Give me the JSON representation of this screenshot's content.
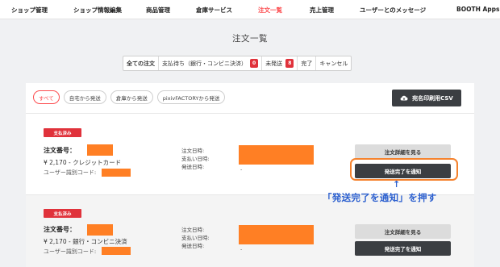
{
  "nav": {
    "items": [
      "ショップ管理",
      "ショップ情報編集",
      "商品管理",
      "倉庫サービス",
      "注文一覧",
      "売上管理",
      "ユーザーとのメッセージ",
      "BOOTH Apps"
    ],
    "active_index": 4,
    "active_color": "#fc4d50"
  },
  "page_title": "注文一覧",
  "status_tabs": [
    {
      "label": "全ての注文"
    },
    {
      "label": "支払待ち（銀行・コンビニ決済）",
      "badge": "0"
    },
    {
      "label": "未発送",
      "badge": "8"
    },
    {
      "label": "完了"
    },
    {
      "label": "キャンセル"
    }
  ],
  "filters": [
    "すべて",
    "自宅から発送",
    "倉庫から発送",
    "pixivFACTORYから発送"
  ],
  "csv_button": {
    "label": "宛名印刷用CSV",
    "icon": "cloud-download-icon"
  },
  "orders": [
    {
      "status": "支払済み",
      "order_label": "注文番号：",
      "price_method": "¥ 2,170 - クレジットカード",
      "user_code_label": "ユーザー識別コード:",
      "date_labels": [
        "注文日時:",
        "支払い日時:",
        "発送日時:"
      ],
      "ship_value": "-",
      "detail_button": "注文詳細を見る",
      "notify_button": "発送完了を通知"
    },
    {
      "status": "支払済み",
      "order_label": "注文番号：",
      "price_method": "¥ 2,170 - 銀行・コンビニ決済",
      "user_code_label": "ユーザー識別コード:",
      "date_labels": [
        "注文日時:",
        "支払い日時:",
        "発送日時:"
      ],
      "ship_value": "-",
      "detail_button": "注文詳細を見る",
      "notify_button": "発送完了を通知"
    }
  ],
  "annotation": {
    "arrow": "↑",
    "text": "「発送完了を通知」を押す",
    "color": "#2b5fcf",
    "highlight_color": "#f5822d"
  },
  "redaction_color": "#ff7f24"
}
